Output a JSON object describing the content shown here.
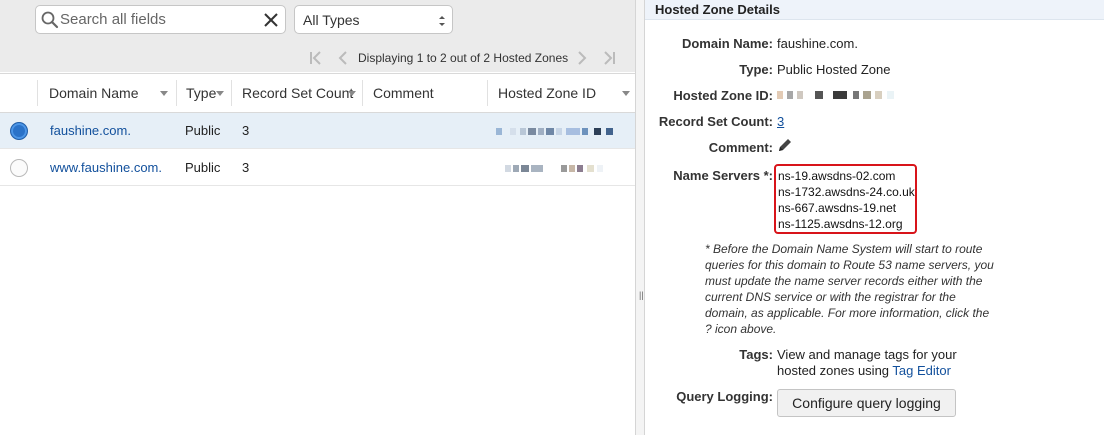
{
  "search": {
    "placeholder": "Search all fields"
  },
  "type_filter": {
    "selected": "All Types"
  },
  "pager": {
    "text": "Displaying 1 to 2 out of 2 Hosted Zones"
  },
  "table": {
    "columns": [
      "Domain Name",
      "Type",
      "Record Set Count",
      "Comment",
      "Hosted Zone ID"
    ],
    "rows": [
      {
        "domain": "faushine.com.",
        "type": "Public",
        "count": "3",
        "selected": true
      },
      {
        "domain": "www.faushine.com.",
        "type": "Public",
        "count": "3",
        "selected": false
      }
    ]
  },
  "details": {
    "title": "Hosted Zone Details",
    "domain_label": "Domain Name:",
    "domain_value": "faushine.com.",
    "type_label": "Type:",
    "type_value": "Public Hosted Zone",
    "zone_id_label": "Hosted Zone ID:",
    "record_count_label": "Record Set Count:",
    "record_count_value": "3",
    "comment_label": "Comment:",
    "name_servers_label": "Name Servers *:",
    "name_servers": [
      "ns-19.awsdns-02.com",
      "ns-1732.awsdns-24.co.uk",
      "ns-667.awsdns-19.net",
      "ns-1125.awsdns-12.org"
    ],
    "note": "* Before the Domain Name System will start to route queries for this domain to Route 53 name servers, you must update the name server records either with the current DNS service or with the registrar for the domain, as applicable. For more information, click the ? icon above.",
    "tags_label": "Tags:",
    "tags_text": "View and manage tags for your hosted zones using",
    "tags_link": "Tag Editor",
    "query_logging_label": "Query Logging:",
    "query_logging_button": "Configure query logging"
  },
  "colors": {
    "accent": "#12509c",
    "selected_row": "#e6eff7",
    "highlight_box": "#d8141a",
    "header_bg": "#eef3fa"
  }
}
